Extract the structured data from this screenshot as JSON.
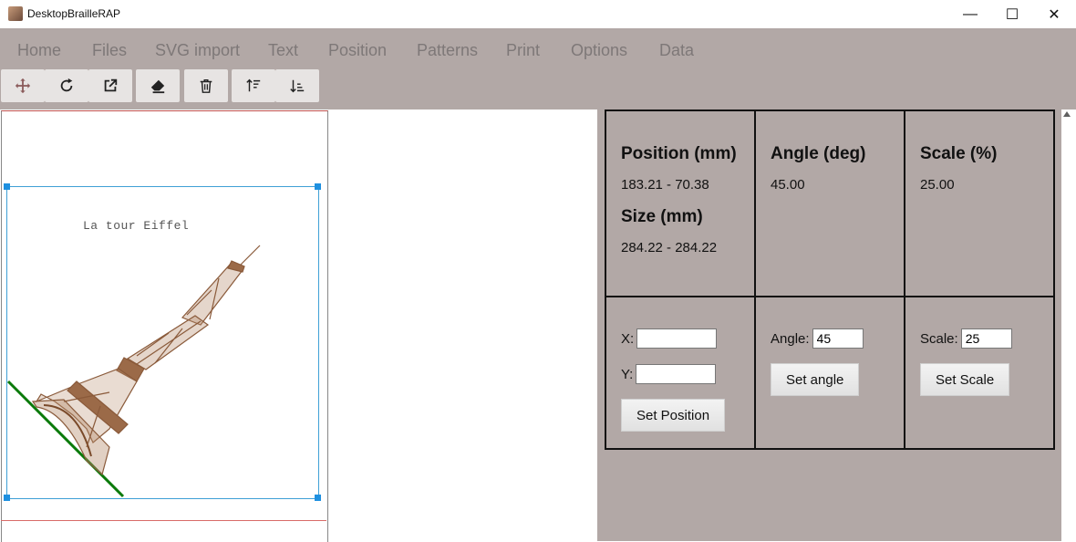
{
  "window": {
    "title": "DesktopBrailleRAP",
    "minimize_glyph": "—",
    "maximize_glyph": "☐",
    "close_glyph": "✕"
  },
  "menu": {
    "items": [
      "Home",
      "Files",
      "SVG import",
      "Text",
      "Position",
      "Patterns",
      "Print",
      "Options",
      "Data"
    ]
  },
  "toolbar": {
    "icons": [
      "move-icon",
      "rotate-icon",
      "external-link-icon",
      "eraser-icon",
      "trash-icon",
      "sort-ascending-icon",
      "sort-descending-icon"
    ]
  },
  "canvas": {
    "svg_title": "La tour Eiffel"
  },
  "props": {
    "position_header": "Position (mm)",
    "position_value": "183.21 - 70.38",
    "size_header": "Size (mm)",
    "size_value": "284.22 - 284.22",
    "angle_header": "Angle (deg)",
    "angle_value": "45.00",
    "scale_header": "Scale (%)",
    "scale_value": "25.00",
    "x_label": "X:",
    "x_value": "",
    "y_label": "Y:",
    "y_value": "",
    "set_position_label": "Set Position",
    "angle_label": "Angle:",
    "angle_input": "45",
    "set_angle_label": "Set angle",
    "scale_label": "Scale:",
    "scale_input": "25",
    "set_scale_label": "Set Scale"
  },
  "colors": {
    "toolbar_bg": "#b2a8a6",
    "menu_text": "#7e7878",
    "selection": "#3fa0d6",
    "ground_line": "#0a7a0a",
    "tower": "#8a5a3a"
  }
}
